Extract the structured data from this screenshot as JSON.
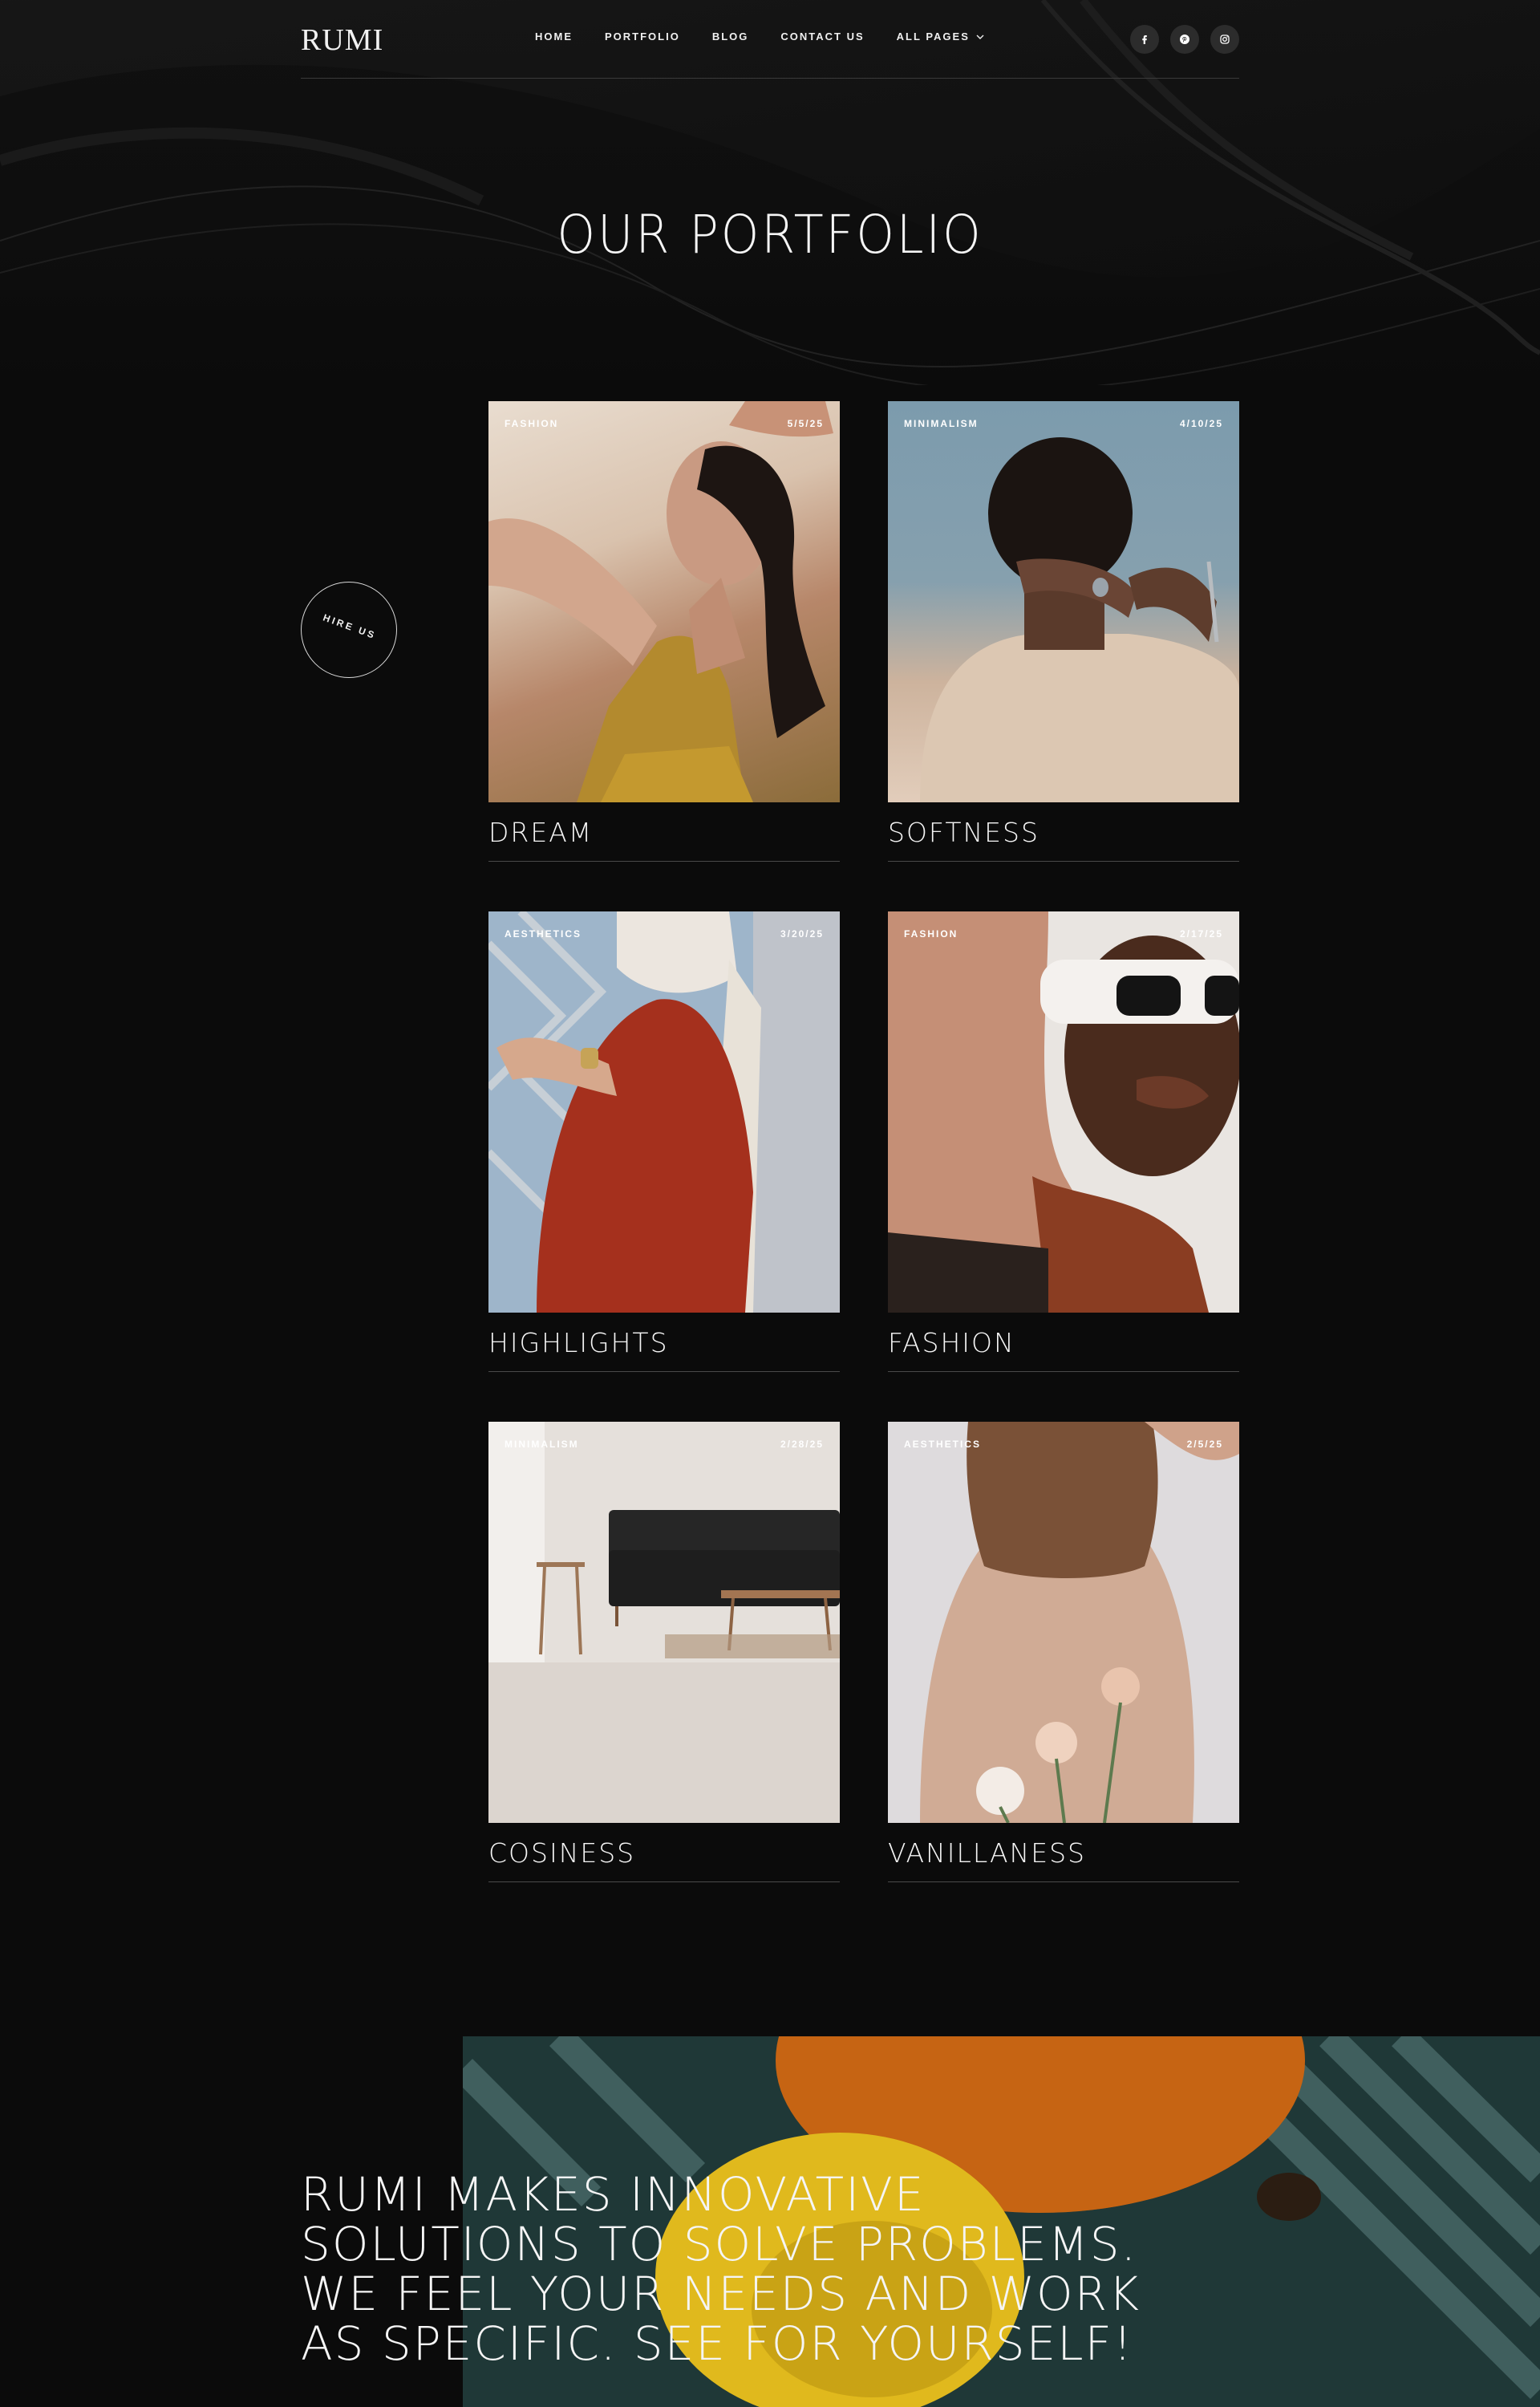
{
  "header": {
    "logo": "RUMI",
    "nav": [
      "HOME",
      "PORTFOLIO",
      "BLOG",
      "CONTACT US",
      "ALL PAGES"
    ],
    "socials": [
      "facebook-icon",
      "pinterest-icon",
      "instagram-icon"
    ]
  },
  "hero": {
    "title": "OUR PORTFOLIO"
  },
  "hire": {
    "label": "HIRE US"
  },
  "portfolio": [
    {
      "tag": "FASHION",
      "date": "5/5/25",
      "title": "DREAM"
    },
    {
      "tag": "MINIMALISM",
      "date": "4/10/25",
      "title": "SOFTNESS"
    },
    {
      "tag": "AESTHETICS",
      "date": "3/20/25",
      "title": "HIGHLIGHTS"
    },
    {
      "tag": "FASHION",
      "date": "2/17/25",
      "title": "FASHION"
    },
    {
      "tag": "MINIMALISM",
      "date": "2/28/25",
      "title": "COSINESS"
    },
    {
      "tag": "AESTHETICS",
      "date": "2/5/25",
      "title": "VANILLANESS"
    }
  ],
  "statement": {
    "lines": [
      "RUMI MAKES INNOVATIVE",
      "SOLUTIONS TO SOLVE PROBLEMS.",
      "WE FEEL YOUR NEEDS AND WORK",
      "AS SPECIFIC. SEE FOR YOURSELF!"
    ]
  },
  "colors": {
    "background": "#0b0b0b",
    "text": "#f5f5f5",
    "divider": "#3a3a3a"
  }
}
